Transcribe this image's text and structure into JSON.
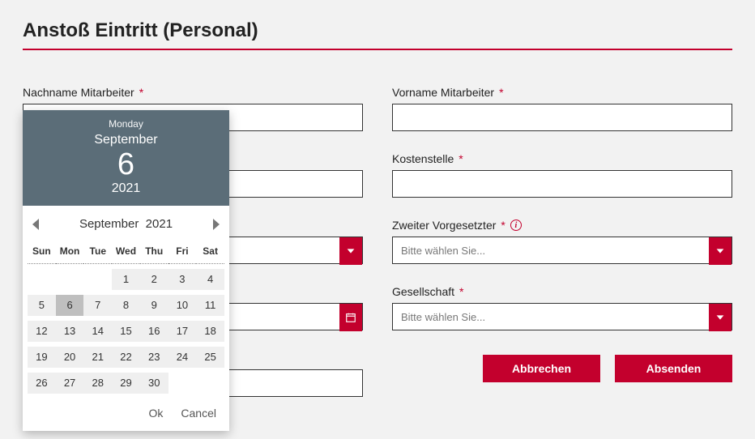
{
  "title": "Anstoß Eintritt (Personal)",
  "required_mark": "*",
  "fields": {
    "nachname": {
      "label": "Nachname Mitarbeiter"
    },
    "vorname": {
      "label": "Vorname Mitarbeiter"
    },
    "kostenstelle": {
      "label": "Kostenstelle"
    },
    "zweiter": {
      "label": "Zweiter Vorgesetzter",
      "placeholder": "Bitte wählen Sie..."
    },
    "gesellschaft": {
      "label": "Gesellschaft",
      "placeholder": "Bitte wählen Sie..."
    }
  },
  "actions": {
    "cancel": "Abbrechen",
    "submit": "Absenden"
  },
  "datepicker": {
    "header": {
      "weekday": "Monday",
      "month": "September",
      "day": "6",
      "year": "2021"
    },
    "nav": {
      "month": "September",
      "year": "2021"
    },
    "dow": [
      "Sun",
      "Mon",
      "Tue",
      "Wed",
      "Thu",
      "Fri",
      "Sat"
    ],
    "grid": [
      [
        "",
        "",
        "",
        "1",
        "2",
        "3",
        "4"
      ],
      [
        "5",
        "6",
        "7",
        "8",
        "9",
        "10",
        "11"
      ],
      [
        "12",
        "13",
        "14",
        "15",
        "16",
        "17",
        "18"
      ],
      [
        "19",
        "20",
        "21",
        "22",
        "23",
        "24",
        "25"
      ],
      [
        "26",
        "27",
        "28",
        "29",
        "30",
        "",
        ""
      ]
    ],
    "selected": "6",
    "ok": "Ok",
    "cancel": "Cancel"
  }
}
